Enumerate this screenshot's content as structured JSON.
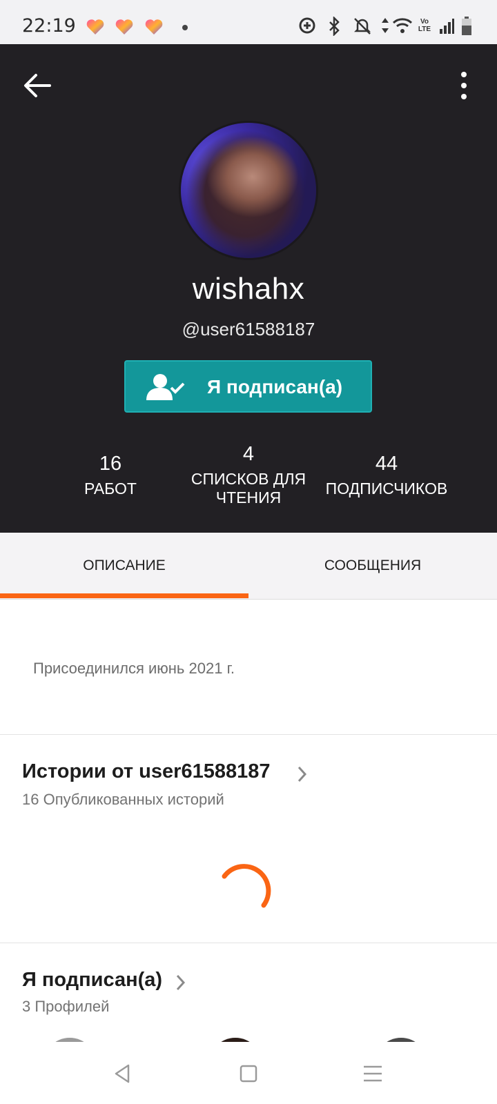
{
  "status_bar": {
    "time": "22:19",
    "network_badge_top": "Vo",
    "network_badge_bottom": "LTE",
    "icons": [
      "heart-app-icon",
      "heart-app-icon",
      "heart-app-icon",
      "dot-icon",
      "data-saver-icon",
      "bluetooth-icon",
      "mute-icon",
      "data-arrows-icon",
      "wifi-icon",
      "volte-icon",
      "signal-icon",
      "battery-icon"
    ]
  },
  "header": {
    "back_icon": "arrow-left-icon",
    "more_icon": "more-vertical-icon"
  },
  "profile": {
    "display_name": "wishahx",
    "username": "@user61588187",
    "follow_button_label": "Я подписан(а)",
    "follow_icon": "user-check-icon"
  },
  "stats": [
    {
      "value": "16",
      "label": "РАБОТ"
    },
    {
      "value": "4",
      "label_line1": "СПИСКОВ ДЛЯ",
      "label_line2": "ЧТЕНИЯ"
    },
    {
      "value": "44",
      "label": "ПОДПИСЧИКОВ"
    }
  ],
  "tabs": [
    {
      "label": "ОПИСАНИЕ",
      "active": true
    },
    {
      "label": "СООБЩЕНИЯ",
      "active": false
    }
  ],
  "about": {
    "joined": "Присоединился июнь 2021 г."
  },
  "stories_section": {
    "title": "Истории от user61588187",
    "subtitle": "16 Опубликованных историй"
  },
  "following_section": {
    "title": "Я подписан(а)",
    "subtitle": "3 Профилей"
  },
  "colors": {
    "header_bg": "#222024",
    "accent": "#fa6514",
    "follow_button": "#13979a"
  }
}
